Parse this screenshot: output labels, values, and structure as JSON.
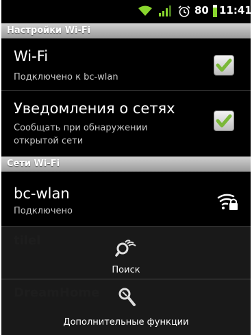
{
  "status_bar": {
    "time": "11:41",
    "battery": "80"
  },
  "section_wifi_settings": {
    "header": "Настройки Wi-Fi"
  },
  "wifi_toggle": {
    "title": "Wi-Fi",
    "subtitle": "Подключено к bc-wlan",
    "checked": true
  },
  "network_notifications": {
    "title": "Уведомления о сетях",
    "subtitle_line1": "Сообщать при обнаружении",
    "subtitle_line2": "открытой сети",
    "checked": true
  },
  "section_networks": {
    "header": "Сети Wi-Fi"
  },
  "network_bc_wlan": {
    "name": "bc-wlan",
    "status": "Подключено"
  },
  "menu": {
    "search_label": "Поиск",
    "advanced_label": "Дополнительные функции"
  },
  "colors": {
    "check": "#7ab838",
    "header_bg": "#b0b0b0",
    "background": "#000000"
  }
}
